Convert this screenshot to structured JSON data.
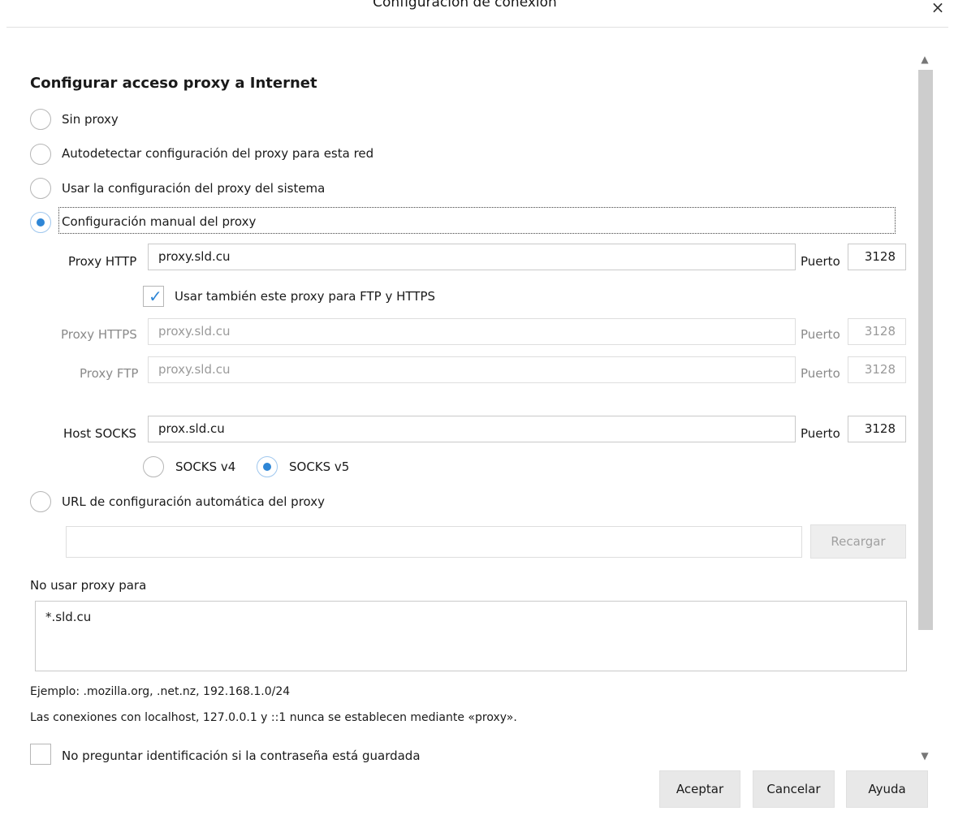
{
  "dialog": {
    "title": "Configuración de conexión",
    "close_glyph": "×"
  },
  "section_title": "Configurar acceso proxy a Internet",
  "radios": {
    "no_proxy": "Sin proxy",
    "autodetect": "Autodetectar configuración del proxy para esta red",
    "system": "Usar la configuración del proxy del sistema",
    "manual": "Configuración manual del proxy",
    "auto_url": "URL de configuración automática del proxy",
    "selected": "manual"
  },
  "http": {
    "label": "Proxy HTTP",
    "value": "proxy.sld.cu",
    "port_label": "Puerto",
    "port": "3128"
  },
  "share_checkbox": {
    "label": "Usar también este proxy para FTP y HTTPS",
    "checked": true
  },
  "https": {
    "label": "Proxy HTTPS",
    "value": "proxy.sld.cu",
    "port_label": "Puerto",
    "port": "3128"
  },
  "ftp": {
    "label": "Proxy FTP",
    "value": "proxy.sld.cu",
    "port_label": "Puerto",
    "port": "3128"
  },
  "socks": {
    "label": "Host SOCKS",
    "value": "prox.sld.cu",
    "port_label": "Puerto",
    "port": "3128",
    "v4_label": "SOCKS v4",
    "v5_label": "SOCKS v5",
    "selected": "v5"
  },
  "auto_url_input": {
    "value": ""
  },
  "reload_button": "Recargar",
  "no_proxy_for": {
    "label": "No usar proxy para",
    "value": "*.sld.cu"
  },
  "example_text": "Ejemplo: .mozilla.org, .net.nz, 192.168.1.0/24",
  "localhost_note": "Las conexiones con localhost, 127.0.0.1 y ::1 nunca se establecen mediante «proxy».",
  "no_prompt_checkbox": {
    "label": "No preguntar identificación si la contraseña está guardada",
    "checked": false
  },
  "buttons": {
    "accept": "Aceptar",
    "cancel": "Cancelar",
    "help": "Ayuda"
  },
  "colors": {
    "accent": "#2e86d6",
    "button_bg": "#e8e8e8",
    "scrollbar": "#cdcdcd"
  }
}
